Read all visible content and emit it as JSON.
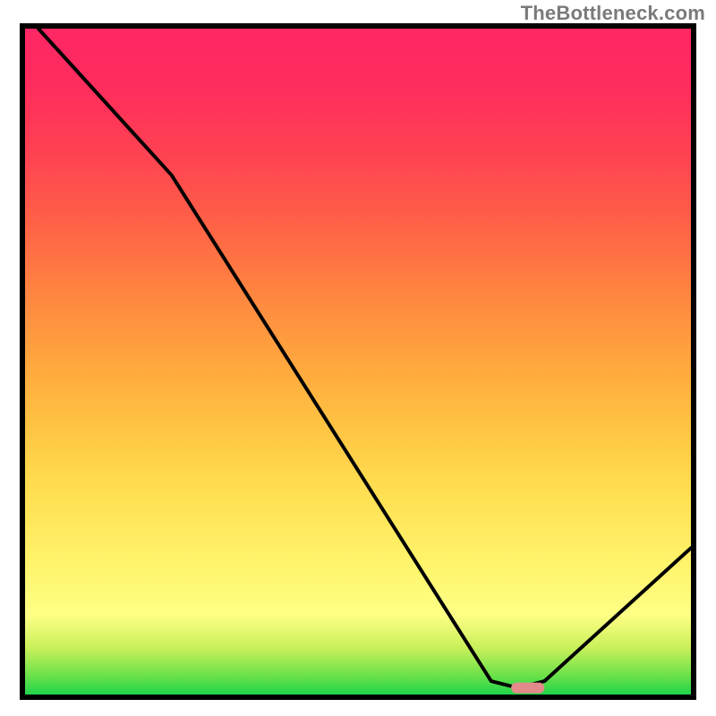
{
  "watermark": "TheBottleneck.com",
  "chart_data": {
    "type": "line",
    "title": "",
    "xlabel": "",
    "ylabel": "",
    "xlim": [
      0,
      100
    ],
    "ylim": [
      0,
      100
    ],
    "series": [
      {
        "name": "bottleneck-curve",
        "x": [
          2,
          22,
          70,
          74,
          78,
          100
        ],
        "y": [
          100,
          78,
          2,
          1,
          2,
          22
        ]
      }
    ],
    "marker": {
      "name": "target-marker",
      "x_start": 73,
      "x_end": 78,
      "y": 1,
      "color": "#e38b8b"
    },
    "gradient_stops": [
      {
        "pos": 0,
        "color": "#1fd44a"
      },
      {
        "pos": 12,
        "color": "#feff85"
      },
      {
        "pos": 50,
        "color": "#ffac3e"
      },
      {
        "pos": 100,
        "color": "#ff2764"
      }
    ]
  }
}
